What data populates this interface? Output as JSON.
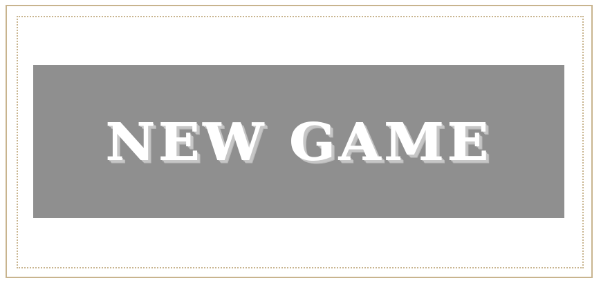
{
  "menu": {
    "new_game_label": "New Game"
  },
  "colors": {
    "button_background": "#8f8f8f",
    "button_text": "#ffffff",
    "frame_border": "#c8b48e"
  }
}
